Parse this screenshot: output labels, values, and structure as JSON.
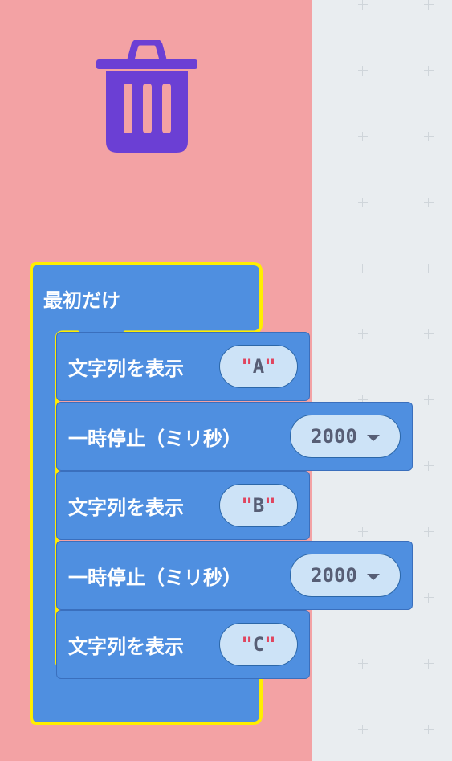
{
  "toolbox": {
    "trash_icon": "trash-icon",
    "bg_color": "#f3a2a4"
  },
  "event_block": {
    "label": "最初だけ"
  },
  "statements": [
    {
      "type": "show_string",
      "label": "文字列を表示",
      "value": "A"
    },
    {
      "type": "pause",
      "label": "一時停止（ミリ秒）",
      "value": "2000"
    },
    {
      "type": "show_string",
      "label": "文字列を表示",
      "value": "B"
    },
    {
      "type": "pause",
      "label": "一時停止（ミリ秒）",
      "value": "2000"
    },
    {
      "type": "show_string",
      "label": "文字列を表示",
      "value": "C"
    }
  ],
  "colors": {
    "block_blue": "#4f8fe0",
    "highlight_yellow": "#ffee00",
    "value_bg": "#cde3f7",
    "quote_red": "#e0455f"
  }
}
